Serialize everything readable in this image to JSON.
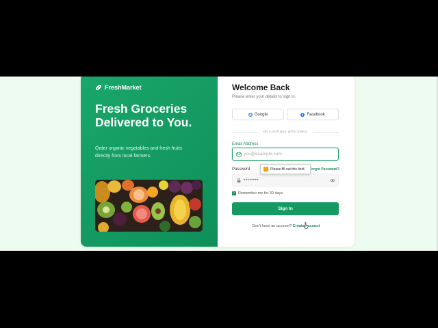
{
  "brand": {
    "name": "FreshMarket",
    "icon": "leaf-icon"
  },
  "hero": {
    "headline": "Fresh Groceries Delivered to You.",
    "subline": "Order organic vegetables and fresh fruits directly from local farmers.",
    "image": "produce-photo"
  },
  "form": {
    "title": "Welcome Back",
    "subtitle": "Please enter your details to sign in.",
    "google_label": "Google",
    "facebook_label": "Facebook",
    "divider_text": "OR CONTINUE WITH EMAIL",
    "email_label": "Email Address",
    "email_placeholder": "you@example.com",
    "password_label": "Password",
    "password_value": "••••••••",
    "forgot_label": "Forgot Password?",
    "remember_label": "Remember me for 30 days",
    "remember_checked": true,
    "signin_label": "Sign In",
    "footer_text": "Don't have an account?",
    "create_label": "Create account"
  },
  "tooltip": {
    "text": "Please fill out this field."
  },
  "colors": {
    "primary": "#159a61",
    "hero": "#1aa76b",
    "page_bg": "#eefbf1"
  }
}
